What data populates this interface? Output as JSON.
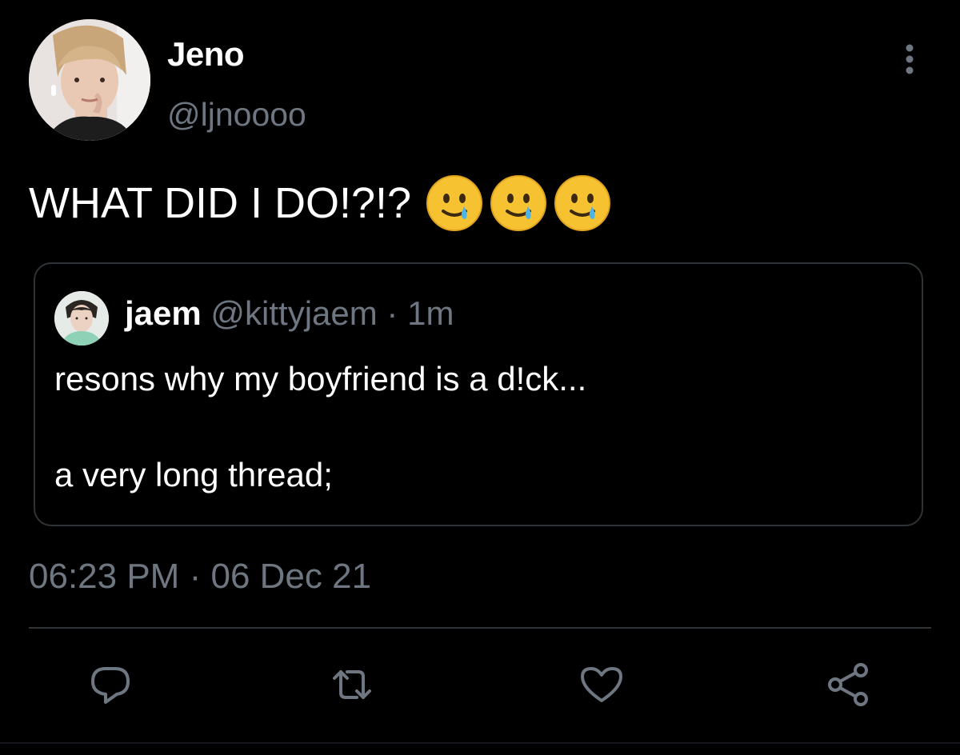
{
  "author": {
    "display_name": "Jeno",
    "handle": "@ljnoooo"
  },
  "tweet": {
    "text": "WHAT DID I DO!?!?",
    "emojis": [
      "smiling-face-with-tear",
      "smiling-face-with-tear",
      "smiling-face-with-tear"
    ],
    "timestamp": "06:23 PM",
    "date": "06 Dec 21",
    "timestamp_separator": "·"
  },
  "quoted_tweet": {
    "display_name": "jaem",
    "handle": "@kittyjaem",
    "separator": "·",
    "time": "1m",
    "line1": "resons why my boyfriend is a d!ck...",
    "line2": "a very long thread;"
  },
  "actions": {
    "reply_icon": "reply-icon",
    "retweet_icon": "retweet-icon",
    "like_icon": "heart-icon",
    "share_icon": "share-icon"
  },
  "colors": {
    "background": "#000000",
    "primary_text": "#ffffff",
    "secondary_text": "#6e7781",
    "border": "#2f3336"
  }
}
